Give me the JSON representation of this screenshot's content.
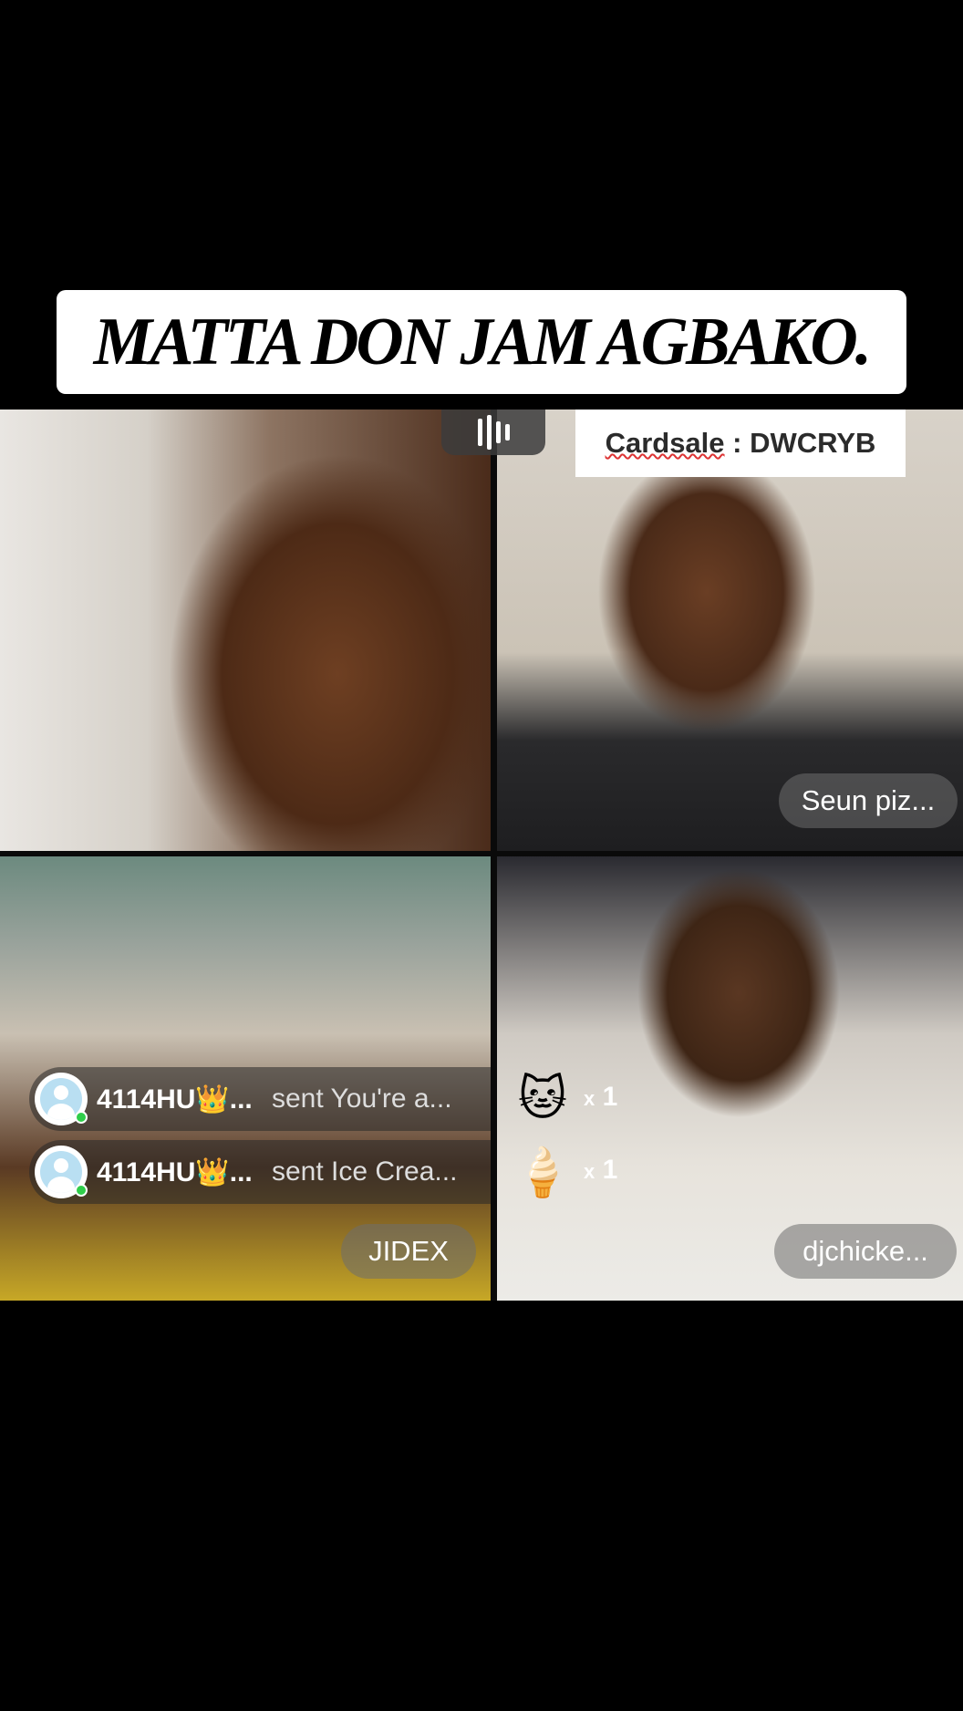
{
  "caption": "MATTA DON JAM AGBAKO.",
  "cardsale": {
    "label": "Cardsale",
    "separator": " : ",
    "code": "DWCRYB"
  },
  "tiles": {
    "top_right": {
      "name": "Seun piz..."
    },
    "bottom_left": {
      "name": "JIDEX"
    },
    "bottom_right": {
      "name": "djchicke..."
    }
  },
  "gifts": [
    {
      "sender": "4114HU👑...",
      "message": "sent You're a...",
      "icon": "cat-gift-icon",
      "count_prefix": "x",
      "count": "1"
    },
    {
      "sender": "4114HU👑...",
      "message": "sent Ice Crea...",
      "icon": "ice-cream-gift-icon",
      "count_prefix": "x",
      "count": "1"
    }
  ],
  "colors": {
    "background": "#000000",
    "caption_bg": "#ffffff",
    "online": "#2fce4a"
  }
}
